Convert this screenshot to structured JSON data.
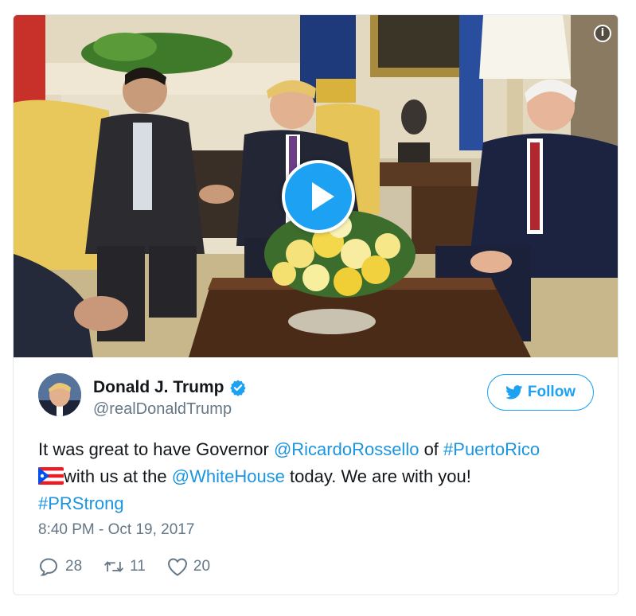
{
  "media": {
    "play_icon": "play-icon",
    "info_icon": "info-icon",
    "info_glyph": "i"
  },
  "author": {
    "display_name": "Donald J. Trump",
    "handle": "@realDonaldTrump",
    "verified_icon": "verified-badge-icon"
  },
  "follow": {
    "label": "Follow",
    "icon": "twitter-bird-icon"
  },
  "tweet": {
    "segments": {
      "t1": "It was great to have Governor ",
      "m1": "@RicardoRossello",
      "t2": " of ",
      "h1": "#PuertoRico",
      "flag": "puerto-rico-flag-icon",
      "t3": "with us at the ",
      "m2": "@WhiteHouse",
      "t4": " today. We are with you!",
      "h2": "#PRStrong"
    },
    "timestamp": "8:40 PM - Oct 19, 2017"
  },
  "actions": {
    "replies": "28",
    "retweets": "11",
    "likes": "20"
  },
  "colors": {
    "brand_blue": "#1da1f2",
    "link_blue": "#1b95e0",
    "muted_gray": "#657786"
  }
}
